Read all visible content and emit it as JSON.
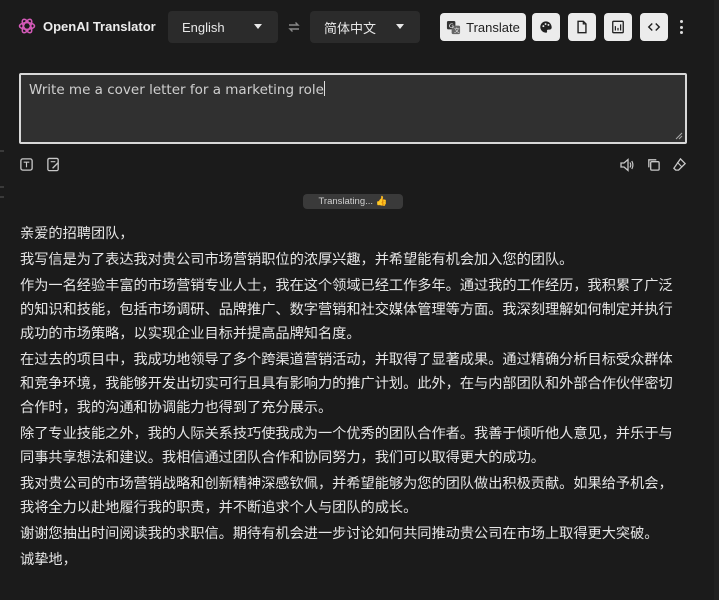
{
  "app": {
    "title": "OpenAI Translator"
  },
  "languages": {
    "source": "English",
    "target": "简体中文"
  },
  "toolbar": {
    "translate_label": "Translate"
  },
  "input": {
    "value": "Write me a cover letter for a marketing role"
  },
  "status": {
    "text": "Translating... 👍"
  },
  "output": {
    "paragraphs": [
      "亲爱的招聘团队，",
      "我写信是为了表达我对贵公司市场营销职位的浓厚兴趣，并希望能有机会加入您的团队。",
      "作为一名经验丰富的市场营销专业人士，我在这个领域已经工作多年。通过我的工作经历，我积累了广泛的知识和技能，包括市场调研、品牌推广、数字营销和社交媒体管理等方面。我深刻理解如何制定并执行成功的市场策略，以实现企业目标并提高品牌知名度。",
      "在过去的项目中，我成功地领导了多个跨渠道营销活动，并取得了显著成果。通过精确分析目标受众群体和竞争环境，我能够开发出切实可行且具有影响力的推广计划。此外，在与内部团队和外部合作伙伴密切合作时，我的沟通和协调能力也得到了充分展示。",
      "除了专业技能之外，我的人际关系技巧使我成为一个优秀的团队合作者。我善于倾听他人意见，并乐于与同事共享想法和建议。我相信通过团队合作和协同努力，我们可以取得更大的成功。",
      "我对贵公司的市场营销战略和创新精神深感钦佩，并希望能够为您的团队做出积极贡献。如果给予机会，我将全力以赴地履行我的职责，并不断追求个人与团队的成长。",
      "谢谢您抽出时间阅读我的求职信。期待有机会进一步讨论如何共同推动贵公司在市场上取得更大突破。",
      "诚挚地，"
    ]
  },
  "icons": {
    "logo": "openai-logo-icon",
    "swap": "swap-arrows-icon",
    "translate": "translate-icon",
    "theme": "palette-icon",
    "file": "file-icon",
    "settings": "settings-panel-icon",
    "code": "code-icon",
    "more": "more-vertical-icon",
    "speak": "speaker-icon",
    "copy": "copy-icon",
    "clear": "eraser-icon"
  },
  "colors": {
    "background": "#1b1b1b",
    "button": "#ececec",
    "select": "#2b2b2b",
    "editor": "#303030"
  }
}
